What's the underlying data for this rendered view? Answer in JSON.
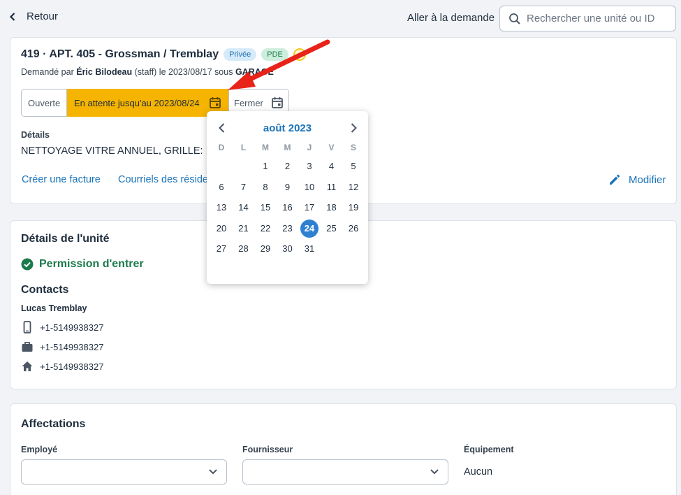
{
  "header": {
    "back_label": "Retour",
    "goto_label": "Aller à la demande",
    "search_placeholder": "Rechercher une unité ou ID"
  },
  "request": {
    "title": "419 · APT. 405 - Grossman / Tremblay",
    "badges": [
      "Privée",
      "PDE"
    ],
    "requested_prefix": "Demandé par",
    "requested_by": "Éric Bilodeau",
    "requested_suffix": "(staff) le 2023/08/17 sous",
    "requested_category": "GARAGE",
    "status": {
      "open_label": "Ouverte",
      "waiting_label": "En attente jusqu'au 2023/08/24",
      "close_label": "Fermer"
    },
    "details_label": "Détails",
    "details_text": "NETTOYAGE VITRE ANNUEL, GRILLE:",
    "link_invoice": "Créer une facture",
    "link_emails": "Courriels des réside",
    "modify_label": "Modifier"
  },
  "unit": {
    "heading": "Détails de l'unité",
    "permission": "Permission d'entrer",
    "contacts_heading": "Contacts",
    "contact_name": "Lucas Tremblay",
    "phones": [
      {
        "icon": "mobile-phone-icon",
        "number": "+1-5149938327"
      },
      {
        "icon": "briefcase-icon",
        "number": "+1-5149938327"
      },
      {
        "icon": "home-icon",
        "number": "+1-5149938327"
      }
    ]
  },
  "assignments": {
    "heading": "Affectations",
    "employee_label": "Employé",
    "supplier_label": "Fournisseur",
    "equipment_label": "Équipement",
    "equipment_value": "Aucun"
  },
  "calendar": {
    "month": "août 2023",
    "weekdays": [
      "D",
      "L",
      "M",
      "M",
      "J",
      "V",
      "S"
    ],
    "first_weekday_index": 2,
    "days_in_month": 31,
    "selected_day": 24
  },
  "colors": {
    "accent": "#1a73b8",
    "waiting": "#f5b400",
    "success": "#1b7a4b",
    "selected_day": "#2f80d1",
    "annotation_arrow": "#e8231a"
  }
}
